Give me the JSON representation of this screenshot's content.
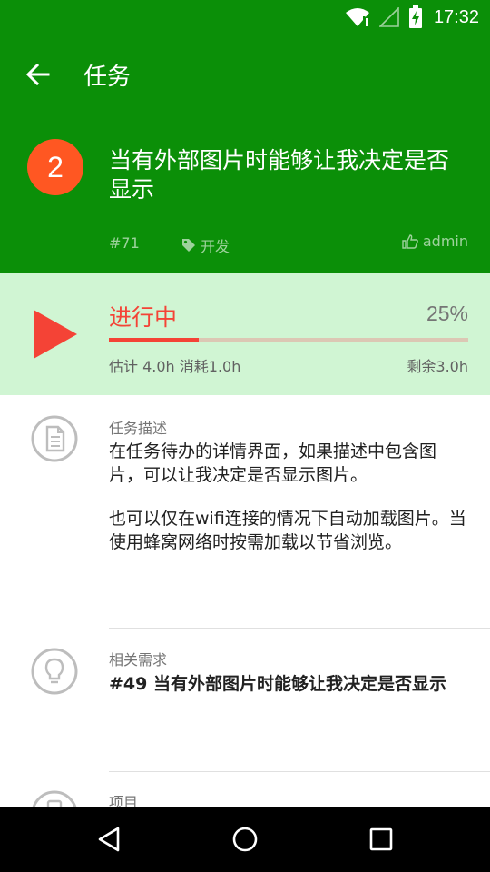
{
  "status_bar": {
    "time": "17:32"
  },
  "toolbar": {
    "title": "任务"
  },
  "task": {
    "priority": "2",
    "title": "当有外部图片时能够让我决定是否显示",
    "id": "#71",
    "tag": "开发",
    "assignee": "admin"
  },
  "progress": {
    "status": "进行中",
    "percent_label": "25%",
    "percent": 25,
    "estimate": "估计 4.0h 消耗1.0h",
    "remaining": "剩余3.0h"
  },
  "description": {
    "label": "任务描述",
    "paragraph1": "在任务待办的详情界面，如果描述中包含图片，可以让我决定是否显示图片。",
    "paragraph2": "也可以仅在wifi连接的情况下自动加载图片。当使用蜂窝网络时按需加载以节省浏览。"
  },
  "related": {
    "label": "相关需求",
    "value": "#49 当有外部图片时能够让我决定是否显示"
  },
  "project": {
    "label": "项目"
  },
  "colors": {
    "header_green": "#0b8f08",
    "progress_bg": "#d0f5d3",
    "accent_red": "#f44336",
    "priority_orange": "#ff5722"
  },
  "icons": {
    "back": "arrow-left-icon",
    "tag": "tag-icon",
    "assignee": "thumb-up-icon",
    "start": "play-icon",
    "description": "document-icon",
    "related": "lightbulb-icon"
  }
}
